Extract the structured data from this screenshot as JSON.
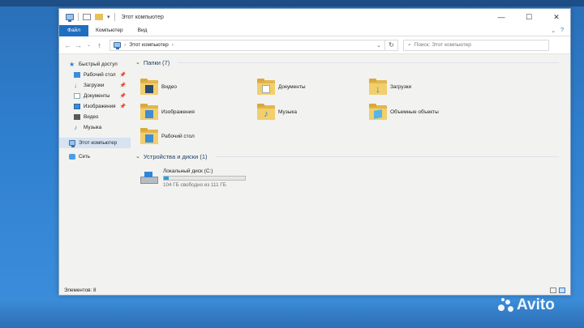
{
  "window": {
    "title": "Этот компьютер",
    "controls": {
      "minimize": "—",
      "maximize": "☐",
      "close": "✕"
    }
  },
  "ribbon": {
    "tabs": [
      {
        "label": "Файл",
        "active": true
      },
      {
        "label": "Компьютер",
        "active": false
      },
      {
        "label": "Вид",
        "active": false
      }
    ],
    "expand": "⌄",
    "help": "?"
  },
  "address_bar": {
    "path_label": "Этот компьютер",
    "search_placeholder": "Поиск: Этот компьютер"
  },
  "sidebar": {
    "items": [
      {
        "label": "Быстрый доступ",
        "icon": "star-icon",
        "pinned": false
      },
      {
        "label": "Рабочий стол",
        "icon": "desktop-folder-icon",
        "pinned": true
      },
      {
        "label": "Загрузки",
        "icon": "downloads-icon",
        "pinned": true
      },
      {
        "label": "Документы",
        "icon": "documents-icon",
        "pinned": true
      },
      {
        "label": "Изображения",
        "icon": "pictures-icon",
        "pinned": true
      },
      {
        "label": "Видео",
        "icon": "video-icon",
        "pinned": false
      },
      {
        "label": "Музыка",
        "icon": "music-icon",
        "pinned": false
      },
      {
        "label": "Этот компьютер",
        "icon": "computer-icon",
        "selected": true
      },
      {
        "label": "Сеть",
        "icon": "network-icon",
        "pinned": false
      }
    ]
  },
  "main": {
    "folders_header": "Папки (7)",
    "folders": [
      {
        "label": "Видео",
        "icon": "video-folder-icon"
      },
      {
        "label": "Документы",
        "icon": "documents-folder-icon"
      },
      {
        "label": "Загрузки",
        "icon": "downloads-folder-icon"
      },
      {
        "label": "Изображения",
        "icon": "pictures-folder-icon"
      },
      {
        "label": "Музыка",
        "icon": "music-folder-icon"
      },
      {
        "label": "Объемные объекты",
        "icon": "3d-objects-folder-icon"
      },
      {
        "label": "Рабочий стол",
        "icon": "desktop-folder-icon"
      }
    ],
    "devices_header": "Устройства и диски (1)",
    "drive": {
      "label": "Локальный диск (C:)",
      "free_text": "104 ГБ свободно из 111 ГБ",
      "used_fraction": 0.063
    }
  },
  "status": {
    "items_count": "Элементов: 8"
  },
  "watermark": {
    "text": "Avito"
  },
  "colors": {
    "accent": "#1f6fc0",
    "usage_bar": "#26a0da",
    "desktop": "#2f7fcf"
  }
}
